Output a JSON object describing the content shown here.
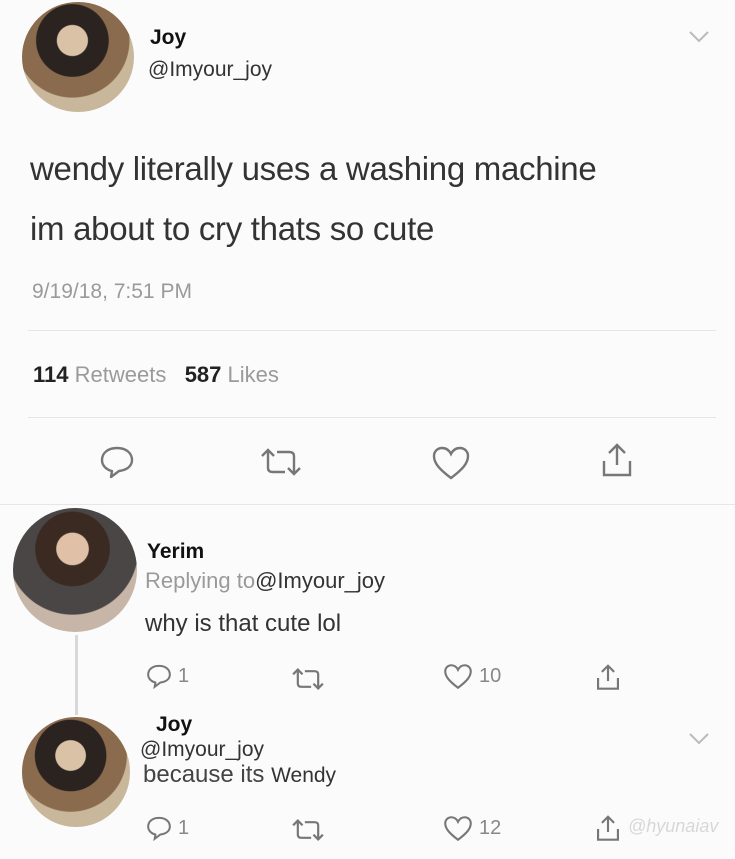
{
  "main_tweet": {
    "name": "Joy",
    "handle": "@Imyour_joy",
    "text_line1": "wendy literally uses a washing machine",
    "text_line2": "im about to cry thats so cute",
    "timestamp": "9/19/18, 7:51 PM",
    "retweets_count": "114",
    "retweets_label": "Retweets",
    "likes_count": "587",
    "likes_label": "Likes"
  },
  "reply1": {
    "name": "Yerim",
    "replying_label": "Replying to",
    "replying_handle": "@Imyour_joy",
    "text": "why is that cute lol",
    "reply_count": "1",
    "like_count": "10"
  },
  "reply2": {
    "name": "Joy",
    "handle": "@Imyour_joy",
    "text_a": "because its",
    "text_b": "Wendy",
    "reply_count": "1",
    "like_count": "12"
  },
  "icons": {
    "reply": "speech-bubble",
    "retweet": "retweet-arrows",
    "like": "heart",
    "share": "share-upload",
    "menu": "chevron-down"
  },
  "watermark": "@hyunaiav"
}
